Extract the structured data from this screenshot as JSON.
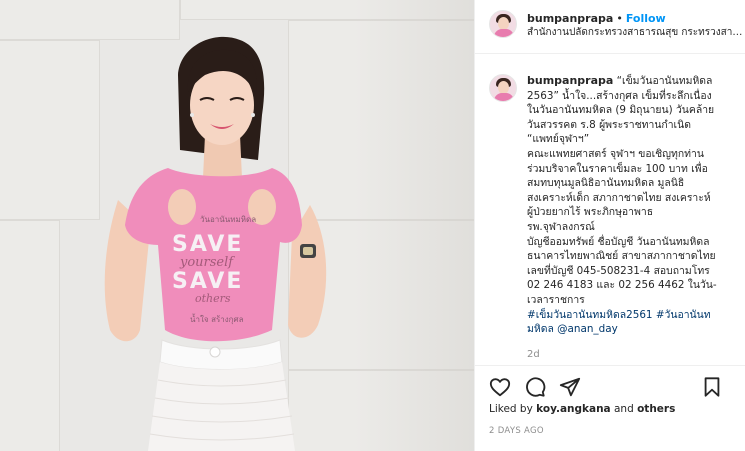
{
  "header": {
    "username": "bumpanprapa",
    "separator": "•",
    "follow_label": "Follow",
    "location": "สำนักงานปลัดกระทรวงสาธารณสุข กระทรวงสาธาร..."
  },
  "caption": {
    "username": "bumpanprapa",
    "lines": [
      "“เข็มวันอานันทมหิดล",
      "2563” น้ำใจ...สร้างกุศล เข็มที่ระลึกเนื่อง",
      "ในวันอานันทมหิดล (9 มิถุนายน) วันคล้าย",
      "วันสวรรคต ร.8 ผู้พระราชทานกำเนิด",
      "“แพทย์จุฬาฯ”",
      "คณะแพทยศาสตร์ จุฬาฯ ขอเชิญทุกท่าน",
      "ร่วมบริจาคในราคาเข็มละ 100 บาท เพื่อ",
      "สมทบทุนมูลนิธิอานันทมหิดล มูลนิธิ",
      "สงเคราะห์เด็ก สภากาชาดไทย สงเคราะห์",
      "ผู้ป่วยยากไร้ พระภิกษุอาพาธ",
      "รพ.จุฬาลงกรณ์",
      "บัญชีออมทรัพย์ ชื่อบัญชี วันอานันทมหิดล",
      "ธนาคารไทยพาณิชย์ สาขาสภากาชาดไทย",
      "เลขที่บัญชี 045-508231-4 สอบถามโทร",
      "02 246 4183 และ 02 256 4462 ในวัน-",
      "เวลาราชการ"
    ],
    "hashtag_line1": "#เข็มวันอานันทมหิดล2561 #วันอานันท",
    "hashtag_line2_tag": "มหิดล",
    "mention": "@anan_day",
    "time_ago": "2d"
  },
  "actions": {
    "icons": [
      "heart-icon",
      "comment-icon",
      "share-icon",
      "bookmark-icon"
    ]
  },
  "likes": {
    "prefix": "Liked by ",
    "user": "koy.angkana",
    "suffix": " and ",
    "others": "others"
  },
  "posted": "2 DAYS AGO",
  "photo": {
    "shirt_line1": "SAVE",
    "shirt_script1": "yourself",
    "shirt_line2": "SAVE",
    "shirt_script2": "others",
    "shirt_top_text": "วันอานันทมหิดล",
    "shirt_bottom_text": "น้ำใจ  สร้างกุศล"
  },
  "colors": {
    "follow": "#0095f6",
    "hashtag": "#00376b",
    "shirt": "#f08dbb"
  }
}
